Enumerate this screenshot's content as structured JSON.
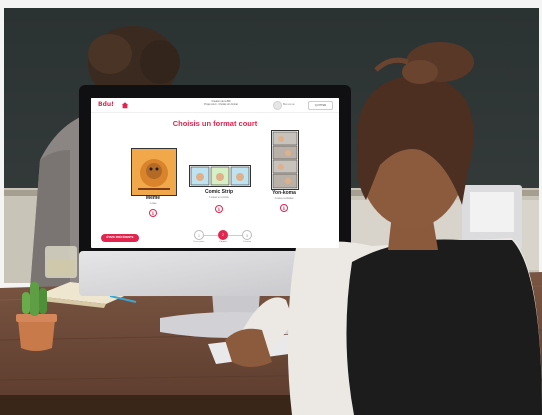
{
  "app": {
    "logo": "Bdu!",
    "header_title_line1": "Création de ta BD",
    "header_title_line2": "Projet court · Choisis ton format",
    "user_name": "Bienvenue",
    "quit_label": "QUITTER"
  },
  "page": {
    "title": "Choisis un format court"
  },
  "formats": [
    {
      "title": "Mème",
      "description": "1 case"
    },
    {
      "title": "Comic Strip",
      "description": "3 cases en continu"
    },
    {
      "title": "Yon-koma",
      "description": "4 cases verticales"
    }
  ],
  "footer": {
    "previous_label": "ÉTAPE PRÉCÉDENTE",
    "steps": [
      {
        "number": "1",
        "label": "Description"
      },
      {
        "number": "2",
        "label": "Format"
      },
      {
        "number": "3",
        "label": "Création"
      }
    ]
  },
  "colors": {
    "accent": "#e3244f",
    "wall": "#2e3535",
    "desk": "#6d4a39",
    "monitor_silver": "#d7d7d9",
    "shirt": "#ece9e4",
    "vest": "#1c1c1c",
    "hair": "#5a3828"
  },
  "icons": {
    "home": "home-icon",
    "info": "info-icon",
    "avatar": "avatar-icon"
  }
}
